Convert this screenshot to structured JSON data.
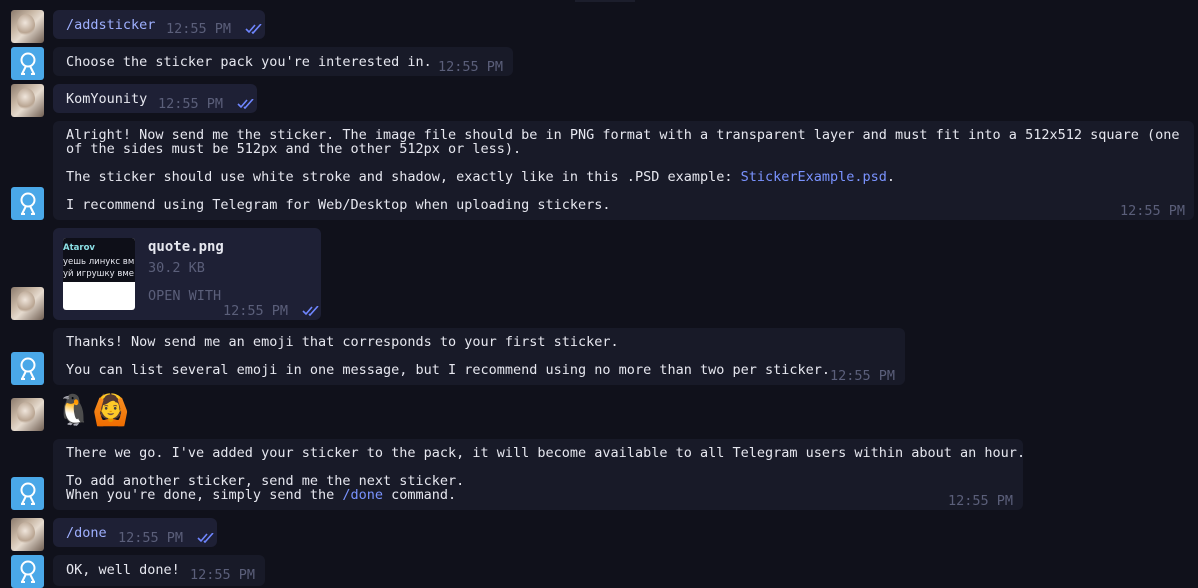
{
  "messages": {
    "m1": {
      "text": "/addsticker",
      "time": "12:55 PM"
    },
    "m2": {
      "text": "Choose the sticker pack you're interested in.",
      "time": "12:55 PM"
    },
    "m3": {
      "text": "KomYounity",
      "time": "12:55 PM"
    },
    "m4": {
      "l1": "Alright! Now send me the sticker. The image file should be in PNG format with a transparent layer and must fit into a 512x512 square (one",
      "l2": "of the sides must be 512px and the other 512px or less).",
      "l3a": "The sticker should use white stroke and shadow, exactly like in this .PSD example: ",
      "l3link": "StickerExample.psd",
      "l3b": ".",
      "l4": "I recommend using Telegram for Web/Desktop when uploading stickers.",
      "time": "12:55 PM"
    },
    "m5": {
      "file_name": "quote.png",
      "file_size": "30.2 KB",
      "action": "OPEN WITH",
      "thumb_title": "Atarov",
      "thumb_line1": "уешь линукс вм",
      "thumb_line2": "уй игрушку вме",
      "time": "12:55 PM"
    },
    "m6": {
      "l1": "Thanks! Now send me an emoji that corresponds to your first sticker.",
      "l2": "You can list several emoji in one message, but I recommend using no more than two per sticker.",
      "time": "12:55 PM"
    },
    "m7": {
      "emoji": "🐧🙆"
    },
    "m8": {
      "l1": "There we go. I've added your sticker to the pack, it will become available to all Telegram users within about an hour.",
      "l2": "To add another sticker, send me the next sticker.",
      "l3a": "When you're done, simply send the ",
      "l3link": "/done",
      "l3b": " command.",
      "time": "12:55 PM"
    },
    "m9": {
      "text": "/done",
      "time": "12:55 PM"
    },
    "m10": {
      "text": "OK, well done!",
      "time": "12:55 PM"
    }
  },
  "colors": {
    "background": "#10111b",
    "bubble_in": "#181a28",
    "bubble_out": "#1e2035",
    "link": "#7a93ff",
    "bot_avatar": "#4aa8e8",
    "muted": "#5b5f7a"
  },
  "icons": {
    "read_receipt": "double-check-icon",
    "bot_avatar": "bot-logo-icon",
    "user_avatar": "user-photo-avatar"
  }
}
